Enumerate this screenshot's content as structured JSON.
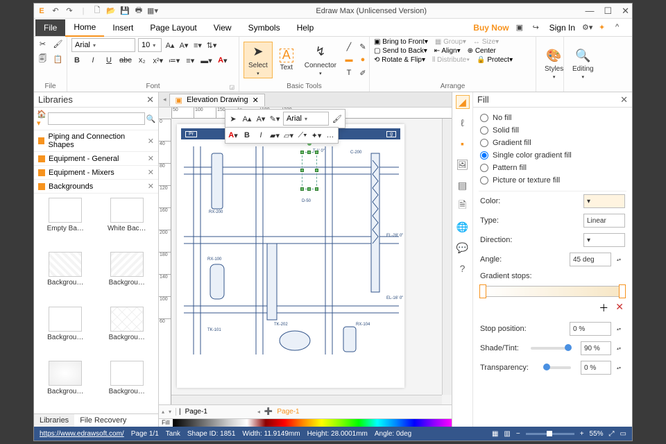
{
  "window": {
    "title": "Edraw Max (Unlicensed Version)"
  },
  "menubar": {
    "file": "File",
    "tabs": [
      "Home",
      "Insert",
      "Page Layout",
      "View",
      "Symbols",
      "Help"
    ],
    "active": "Home",
    "buy_now": "Buy Now",
    "sign_in": "Sign In"
  },
  "ribbon": {
    "file_group": "File",
    "font_group": "Font",
    "font_name": "Arial",
    "font_size": "10",
    "basic_tools_group": "Basic Tools",
    "select_label": "Select",
    "text_label": "Text",
    "connector_label": "Connector",
    "arrange_group": "Arrange",
    "bring_front": "Bring to Front",
    "send_back": "Send to Back",
    "rotate_flip": "Rotate & Flip",
    "group": "Group",
    "align": "Align",
    "distribute": "Distribute",
    "size": "Size",
    "center": "Center",
    "protect": "Protect",
    "styles_label": "Styles",
    "editing_label": "Editing"
  },
  "libraries": {
    "title": "Libraries",
    "categories": [
      "Piping and Connection Shapes",
      "Equipment - General",
      "Equipment - Mixers",
      "Backgrounds"
    ],
    "items": [
      "Empty Ba…",
      "White Bac…",
      "Backgrou…",
      "Backgrou…",
      "Backgrou…",
      "Backgrou…",
      "Backgrou…",
      "Backgrou…"
    ],
    "tabs": [
      "Libraries",
      "File Recovery"
    ]
  },
  "document": {
    "tab_name": "Elevation Drawing",
    "float_font": "Arial",
    "ruler_h": [
      "50",
      "100",
      "150",
      "180",
      "220"
    ],
    "ruler_v": [
      "0",
      "40",
      "80",
      "120",
      "160",
      "200",
      "180",
      "140",
      "100",
      "60"
    ],
    "banner_left": "Pr",
    "banner_right": "g",
    "canvas_labels": {
      "rx200": "RX-200",
      "rx100": "RX-100",
      "tk101": "TK-101",
      "tk202": "TK-202",
      "c200": "C-200",
      "d50": "D-50",
      "rx104": "RX-104",
      "el28": "EL-28' 0\"",
      "el16": "EL-16' 0\"",
      "t10": "T-1' 0\""
    },
    "page_nav": "Page-1",
    "page_active": "Page-1",
    "fill_label": "Fill"
  },
  "fill_panel": {
    "title": "Fill",
    "options": [
      "No fill",
      "Solid fill",
      "Gradient fill",
      "Single color gradient fill",
      "Pattern fill",
      "Picture or texture fill"
    ],
    "selected": "Single color gradient fill",
    "color_label": "Color:",
    "type_label": "Type:",
    "type_value": "Linear",
    "direction_label": "Direction:",
    "angle_label": "Angle:",
    "angle_value": "45 deg",
    "stops_label": "Gradient stops:",
    "stop_pos_label": "Stop position:",
    "stop_pos_value": "0 %",
    "shade_label": "Shade/Tint:",
    "shade_value": "90 %",
    "trans_label": "Transparency:",
    "trans_value": "0 %"
  },
  "statusbar": {
    "url": "https://www.edrawsoft.com/",
    "page": "Page 1/1",
    "shape": "Tank",
    "shape_id": "Shape ID: 1851",
    "width": "Width: 11.9149mm",
    "height": "Height: 28.0001mm",
    "angle": "Angle: 0deg",
    "zoom": "55%"
  }
}
